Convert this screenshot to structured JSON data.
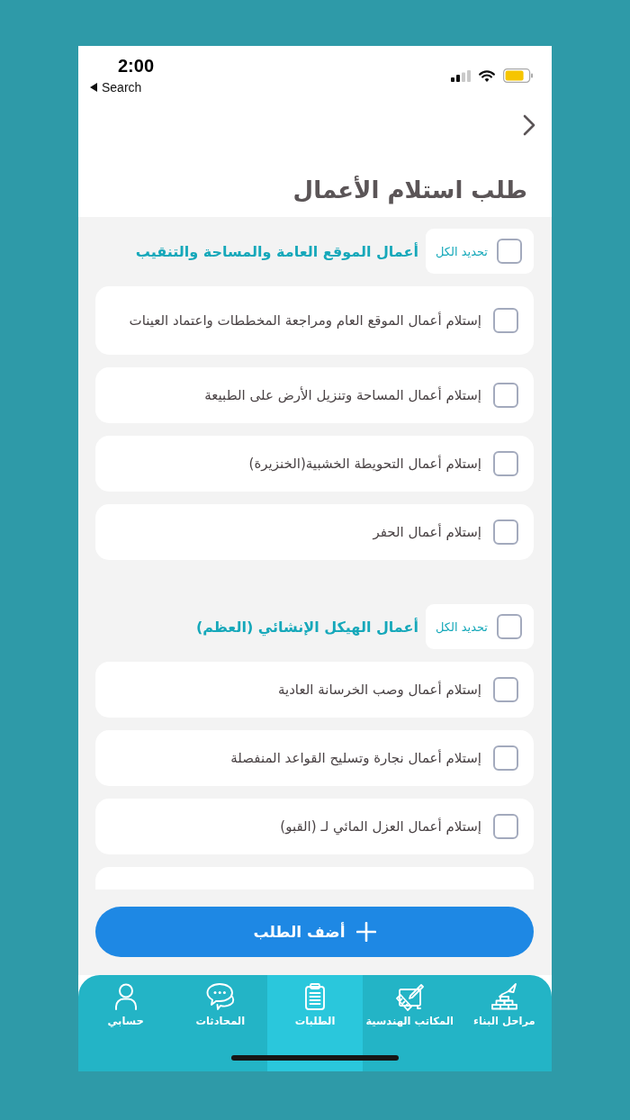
{
  "status_bar": {
    "time": "2:00",
    "back_label": "Search"
  },
  "header": {
    "title": "طلب استلام الأعمال"
  },
  "sections": [
    {
      "title": "أعمال الموقع العامة والمساحة والتنقيب",
      "select_all": {
        "label": "تحديد الكل",
        "checked": false
      },
      "items": [
        {
          "label": "إستلام أعمال الموقع العام ومراجعة المخططات واعتماد العينات",
          "checked": false
        },
        {
          "label": "إستلام أعمال المساحة وتنزيل الأرض على الطبيعة",
          "checked": false
        },
        {
          "label": "إستلام أعمال التحويطة الخشبية(الخنزيرة)",
          "checked": false
        },
        {
          "label": "إستلام أعمال الحفر",
          "checked": false
        }
      ]
    },
    {
      "title": "أعمال الهيكل الإنشائي (العظم)",
      "select_all": {
        "label": "تحديد الكل",
        "checked": false
      },
      "items": [
        {
          "label": "إستلام أعمال وصب الخرسانة العادية",
          "checked": false
        },
        {
          "label": "إستلام أعمال نجارة وتسليح القواعد المنفصلة",
          "checked": false
        },
        {
          "label": "إستلام أعمال العزل المائي لـ (القبو)",
          "checked": false
        }
      ]
    }
  ],
  "list": {
    "more_below": true
  },
  "submit_button": {
    "label": "أضف الطلب"
  },
  "tab_bar": {
    "tabs": [
      {
        "label": "مراحل البناء",
        "selected": false
      },
      {
        "label": "المكاتب الهندسية",
        "selected": false
      },
      {
        "label": "الطلبات",
        "selected": true
      },
      {
        "label": "المحادثات",
        "selected": false
      },
      {
        "label": "حسابي",
        "selected": false
      }
    ]
  }
}
